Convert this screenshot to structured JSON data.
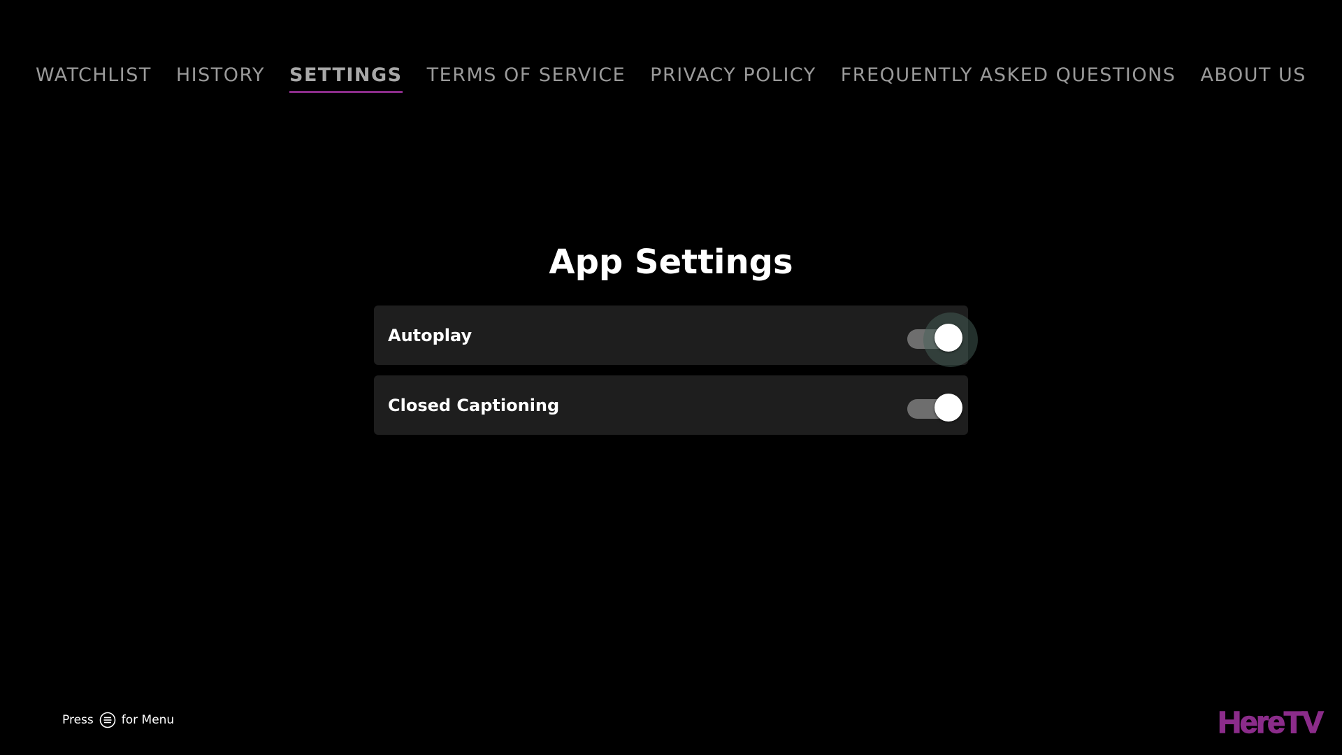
{
  "nav": {
    "items": [
      {
        "label": "WATCHLIST"
      },
      {
        "label": "HISTORY"
      },
      {
        "label": "SETTINGS",
        "active": true
      },
      {
        "label": "TERMS OF SERVICE"
      },
      {
        "label": "PRIVACY POLICY"
      },
      {
        "label": "FREQUENTLY ASKED QUESTIONS"
      },
      {
        "label": "ABOUT US"
      }
    ]
  },
  "page": {
    "title": "App Settings"
  },
  "settings": [
    {
      "label": "Autoplay",
      "enabled": true,
      "focused": true
    },
    {
      "label": "Closed Captioning",
      "enabled": true,
      "focused": false
    }
  ],
  "footer": {
    "hint_prefix": "Press",
    "hint_icon": "menu-button-icon",
    "hint_suffix": "for Menu",
    "logo_text": "HereTV"
  },
  "colors": {
    "background": "#000000",
    "accent": "#8b2c8a",
    "row_background": "#1e1e1e",
    "nav_text": "#9a9a9a"
  }
}
